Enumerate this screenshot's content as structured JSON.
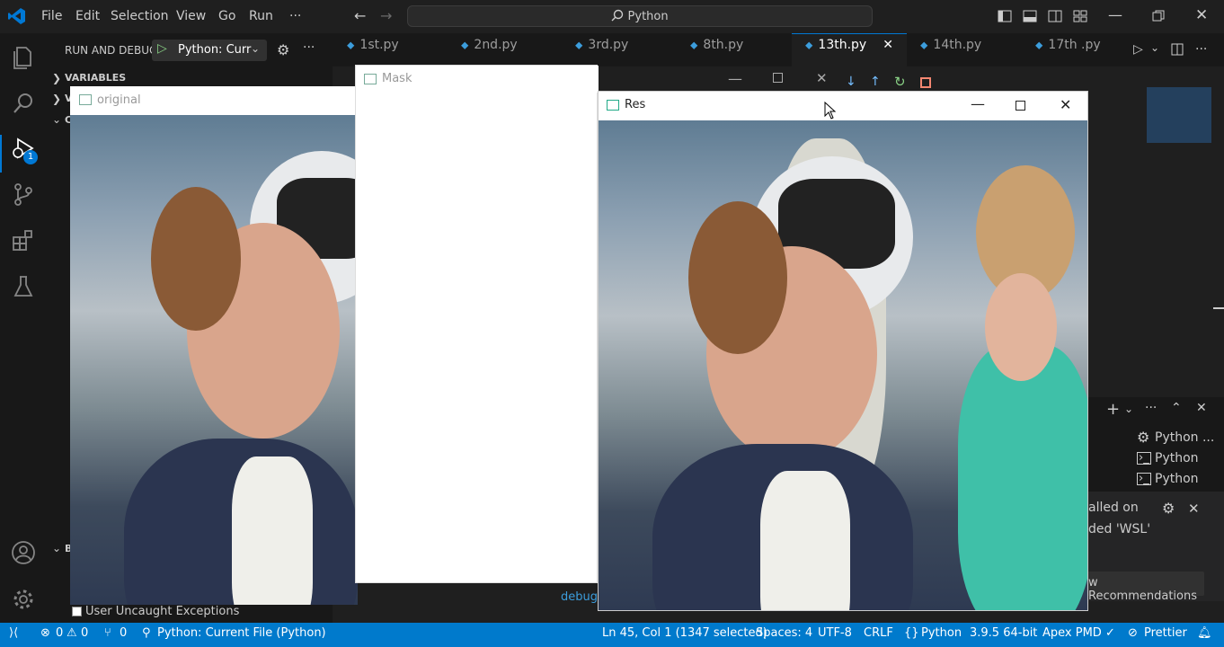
{
  "titlebar": {
    "menu": [
      "File",
      "Edit",
      "Selection",
      "View",
      "Go",
      "Run",
      "···"
    ],
    "search_text": "Python"
  },
  "activity": {
    "run_badge": "1"
  },
  "sidebar": {
    "header": "RUN AND DEBUG",
    "config": "Python: Curr",
    "sections": {
      "variables": "VARIABLES",
      "watch": "V",
      "callstack": "C",
      "breakpoints": "B"
    },
    "uncaught": "User Uncaught Exceptions"
  },
  "tabs": [
    "1st.py",
    "2nd.py",
    "3rd.py",
    "8th.py",
    "13th.py",
    "14th.py",
    "17th .py"
  ],
  "windows": {
    "original": {
      "title": "original"
    },
    "mask": {
      "title": "Mask"
    },
    "res": {
      "title": "Res"
    }
  },
  "terminal_panel": {
    "items": [
      "Python ...",
      "Python",
      "Python"
    ],
    "notif_line1": "alled on",
    "notif_line2": "ded 'WSL'",
    "notif_button": "w Recommendations",
    "partial_debug": "debug"
  },
  "statusbar": {
    "errors": "0",
    "warnings": "0",
    "ports": "0",
    "debug": "Python: Current File (Python)",
    "cursor": "Ln 45, Col 1 (1347 selected)",
    "spaces": "Spaces: 4",
    "encoding": "UTF-8",
    "eol": "CRLF",
    "language": "Python",
    "interpreter": "3.9.5 64-bit",
    "apex": "Apex PMD ✓",
    "prettier": "Prettier"
  },
  "colors": {
    "accent": "#007acc",
    "vscode_blue": "#0078d4",
    "tab_active_border": "#0078d4"
  }
}
